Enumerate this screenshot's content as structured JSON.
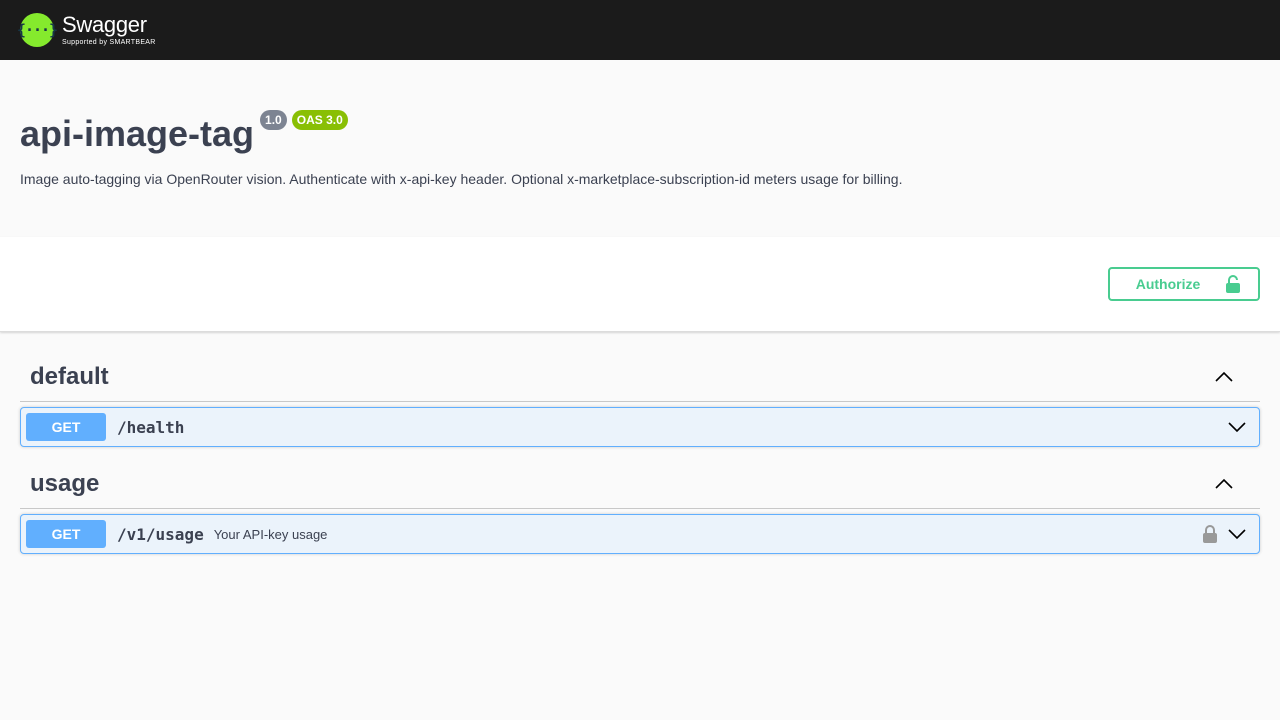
{
  "topbar": {
    "logo_title": "Swagger",
    "logo_subtitle": "Supported by SMARTBEAR",
    "logo_glyph": "{···}",
    "logo_color": "#85ea2d"
  },
  "info": {
    "title": "api-image-tag",
    "version_badge": "1.0",
    "oas_badge": "OAS 3.0",
    "description": "Image auto-tagging via OpenRouter vision. Authenticate with x-api-key header. Optional x-marketplace-subscription-id meters usage for billing."
  },
  "scheme": {
    "authorize_label": "Authorize",
    "authorize_icon": "unlock-icon",
    "accent_color": "#49cc90"
  },
  "tags": [
    {
      "name": "default",
      "expanded": true,
      "operations": [
        {
          "method": "GET",
          "path": "/health",
          "summary": "",
          "locked": false
        }
      ]
    },
    {
      "name": "usage",
      "expanded": true,
      "operations": [
        {
          "method": "GET",
          "path": "/v1/usage",
          "summary": "Your API-key usage",
          "locked": true
        }
      ]
    }
  ],
  "colors": {
    "get_method": "#61affe",
    "get_background": "#ebf3fb",
    "text": "#3b4151"
  }
}
